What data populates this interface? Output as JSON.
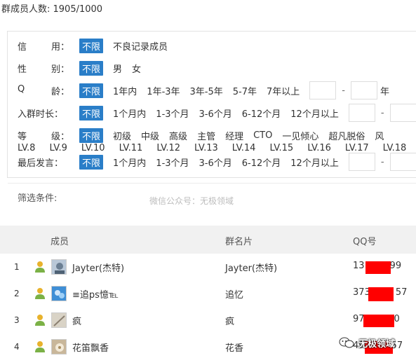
{
  "header": {
    "member_count": "群成员人数: 1905/1000"
  },
  "filters": {
    "credit": {
      "label_a": "信",
      "label_b": "用：",
      "options": [
        "不限",
        "不良记录成员"
      ]
    },
    "gender": {
      "label_a": "性",
      "label_b": "别：",
      "options": [
        "不限",
        "男",
        "女"
      ]
    },
    "q_age": {
      "label_a": "Q",
      "label_b": "龄：",
      "options": [
        "不限",
        "1年内",
        "1年-3年",
        "3年-5年",
        "5-7年",
        "7年以上"
      ],
      "dash": "-",
      "unit": "年"
    },
    "join_time": {
      "label": "入群时长：",
      "options": [
        "不限",
        "1个月内",
        "1-3个月",
        "3-6个月",
        "6-12个月",
        "12个月以上"
      ],
      "dash": "-"
    },
    "level": {
      "label_a": "等",
      "label_b": "级：",
      "options": [
        "不限",
        "初级",
        "中级",
        "高级",
        "主管",
        "经理",
        "CTO",
        "一见倾心",
        "超凡脱俗",
        "风"
      ]
    },
    "levels": [
      "LV.8",
      "LV.9",
      "LV.10",
      "LV.11",
      "LV.12",
      "LV.13",
      "LV.14",
      "LV.15",
      "LV.16",
      "LV.17",
      "LV.18"
    ],
    "last_post": {
      "label": "最后发言：",
      "options": [
        "不限",
        "1个月内",
        "1-3个月",
        "3-6个月",
        "6-12个月",
        "12个月以上"
      ],
      "dash": "-"
    },
    "condition_label": "筛选条件:",
    "watermark": "微信公众号：无极领域"
  },
  "table": {
    "headers": {
      "member": "成员",
      "card": "群名片",
      "qq": "QQ号"
    },
    "rows": [
      {
        "index": "1",
        "name": "Jayter(杰特)",
        "card": "Jayter(杰特)",
        "qq_start": "13",
        "qq_end": "99"
      },
      {
        "index": "2",
        "name": "≡追ps憶℡",
        "card": "追忆",
        "qq_start": "373",
        "qq_end": "57"
      },
      {
        "index": "3",
        "name": "疯",
        "card": "疯",
        "qq_start": "97",
        "qq_end": "0"
      },
      {
        "index": "4",
        "name": "花笛飘香",
        "card": "花香",
        "qq_start": "49",
        "qq_end": "57"
      }
    ]
  },
  "brand": {
    "text": "无极领域",
    "icon": "wechat-icon"
  },
  "colors": {
    "active": "#2a7ec8",
    "redact": "#ff0000",
    "header_bg": "#f1f1f1"
  }
}
